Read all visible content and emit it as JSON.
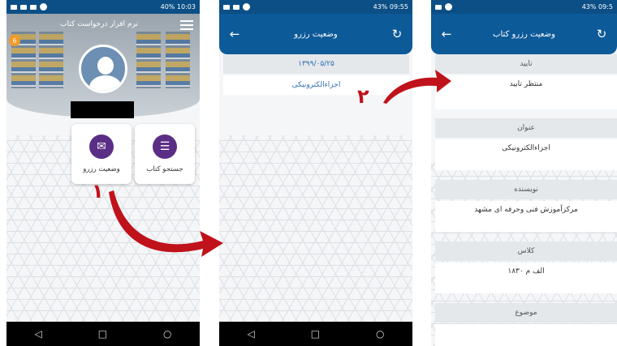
{
  "phone1": {
    "status": {
      "right": "40% 10:03"
    },
    "header_title": "نرم افزار درخواست کتاب",
    "badge": "6",
    "tiles": [
      {
        "label": "جستجو کتاب",
        "icon": "books-icon"
      },
      {
        "label": "وضعیت رزرو",
        "icon": "mail-icon"
      }
    ],
    "step_number": "١"
  },
  "phone2": {
    "status": {
      "right": "43% 09:55"
    },
    "title": "وضعیت رزرو",
    "date": "۱۳۹۹/۰۵/۲۵",
    "item": "اجزاءالکترونیکی",
    "step_number": "٢"
  },
  "phone3": {
    "status": {
      "right": "43% 09:5"
    },
    "title": "وضعیت رزرو کتاب",
    "sections": [
      {
        "label": "تایید",
        "value": "منتظر تایید"
      },
      {
        "label": "عنوان",
        "value": "اجزاءالکترونیکی"
      },
      {
        "label": "نویسنده",
        "value": "مرکزآموزش فنی وحرفه ای مشهد"
      },
      {
        "label": "کلاس",
        "value": "الف م ۱۸۳۰"
      },
      {
        "label": "موضوع",
        "value": ""
      }
    ]
  },
  "colors": {
    "appbar": "#0d5a99",
    "statusbar": "#0b4f86",
    "tile_icon": "#5b2e86",
    "arrow": "#c0121a"
  }
}
